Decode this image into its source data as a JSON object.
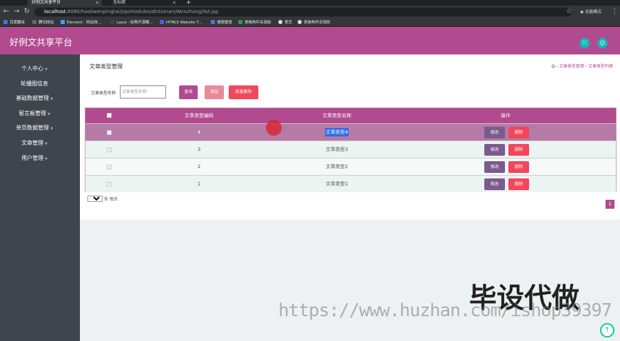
{
  "browser": {
    "tabs": [
      {
        "label": "好例文共享平台",
        "active": true
      },
      {
        "label": "无标题",
        "active": false
      }
    ],
    "url_host": "localhost",
    "url_path": ":8080/haoliwenpingtai/jsp/modules/dictionaryWenzhang/list.jsp",
    "profile_label": "无痕模式",
    "bookmarks": [
      "百度翻译",
      "腾讯网站",
      "Element - 网站快...",
      "Layui - 经典开源模...",
      "HTML5 Website T...",
      "搜索壁纸",
      "表格构件名调前",
      "首页",
      "表格构件名规则"
    ]
  },
  "header": {
    "logo": "好例文共享平台",
    "accent": "#b14a8f"
  },
  "sidebar": {
    "items": [
      {
        "label": "个人中心",
        "caret": true
      },
      {
        "label": "轮播图信息",
        "caret": false
      },
      {
        "label": "基础数据管理",
        "caret": true
      },
      {
        "label": "留言板管理",
        "caret": true
      },
      {
        "label": "单页数据管理",
        "caret": true
      },
      {
        "label": "文章管理",
        "caret": true
      },
      {
        "label": "用户管理",
        "caret": true
      }
    ]
  },
  "page": {
    "title": "文章类型管理",
    "breadcrumb": [
      "文章类型管理",
      "文章类型列表"
    ]
  },
  "filter": {
    "label": "文章类型名称",
    "placeholder": "文章类型名称",
    "search_label": "查询",
    "add_label": "添加",
    "bulk_delete_label": "批量删除"
  },
  "table": {
    "columns": [
      "文章类型编码",
      "文章类型名称",
      "操作"
    ],
    "rows": [
      {
        "code": "4",
        "name": "文章类型4",
        "selected": true
      },
      {
        "code": "3",
        "name": "文章类型3",
        "selected": false
      },
      {
        "code": "2",
        "name": "文章类型2",
        "selected": false
      },
      {
        "code": "1",
        "name": "文章类型1",
        "selected": false
      }
    ],
    "edit_label": "修改",
    "delete_label": "删除"
  },
  "pagination": {
    "page_size": "10",
    "per_page_label": "条 每页",
    "current_page": "1"
  },
  "watermark": {
    "title": "毕设代做",
    "url": "https://www.huzhan.com/ishop39397"
  }
}
